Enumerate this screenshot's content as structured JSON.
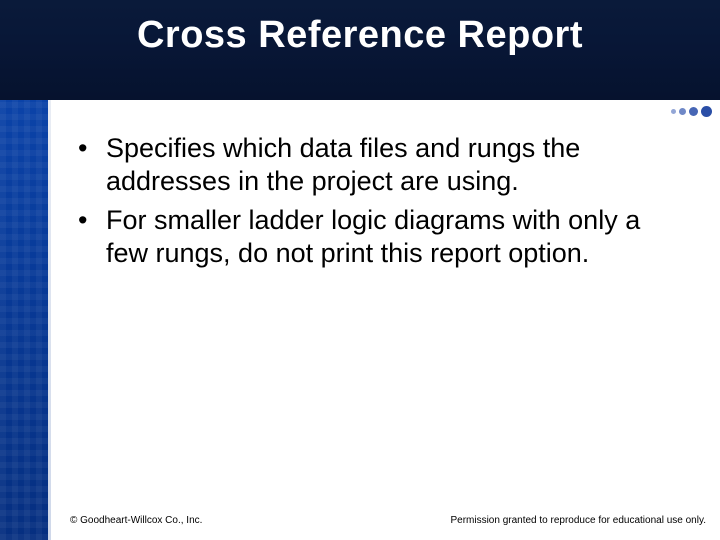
{
  "header": {
    "title": "Cross Reference Report"
  },
  "content": {
    "bullets": [
      "Specifies which data files and rungs the addresses in the project are using.",
      "For smaller ladder logic diagrams with only a few rungs, do not print this report option."
    ]
  },
  "footer": {
    "left": "© Goodheart-Willcox Co., Inc.",
    "right": "Permission granted to reproduce for educational use only."
  }
}
